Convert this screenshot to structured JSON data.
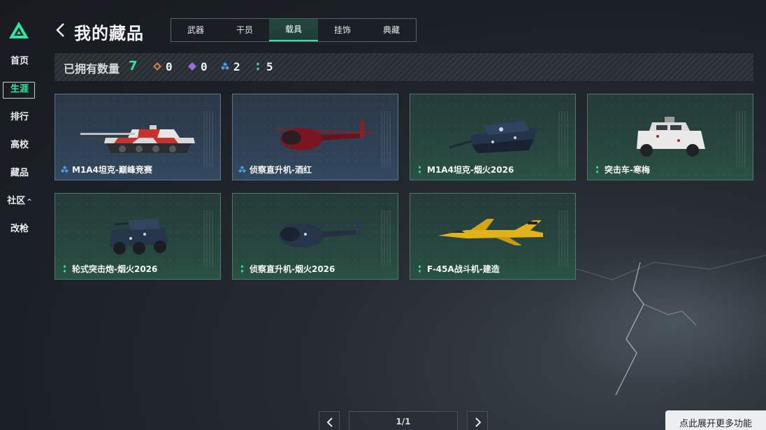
{
  "sidebar": {
    "items": [
      {
        "label": "首页"
      },
      {
        "label": "生涯"
      },
      {
        "label": "排行"
      },
      {
        "label": "高校"
      },
      {
        "label": "藏品"
      },
      {
        "label": "社区"
      },
      {
        "label": "改枪"
      }
    ],
    "active_index": 1
  },
  "header": {
    "title": "我的藏品",
    "tabs": [
      {
        "label": "武器"
      },
      {
        "label": "干员"
      },
      {
        "label": "载具"
      },
      {
        "label": "挂饰"
      },
      {
        "label": "典藏"
      }
    ],
    "active_tab": "载具"
  },
  "owned": {
    "label": "已拥有数量",
    "total": "7",
    "rarities": [
      {
        "icon": "orange-diamond-icon",
        "color": "#d9784a",
        "count": "0"
      },
      {
        "icon": "purple-diamond-icon",
        "color": "#9b6bdc",
        "count": "0"
      },
      {
        "icon": "blue-diamond-icon",
        "color": "#4c9ce0",
        "count": "2"
      },
      {
        "icon": "green-diamond-icon",
        "color": "#2ee6a0",
        "count": "5"
      }
    ]
  },
  "items": [
    {
      "name": "M1A4坦克-巅峰竞赛",
      "rarity": "blue",
      "icon": "blue-diamond-icon",
      "image": "red-white-tank"
    },
    {
      "name": "侦察直升机-酒红",
      "rarity": "blue",
      "icon": "blue-diamond-icon",
      "image": "wine-red-helicopter"
    },
    {
      "name": "M1A4坦克-烟火2026",
      "rarity": "green",
      "icon": "green-diamond-icon",
      "image": "navy-fireworks-tank"
    },
    {
      "name": "突击车-寒梅",
      "rarity": "green",
      "icon": "green-diamond-icon",
      "image": "white-plum-assault-vehicle"
    },
    {
      "name": "轮式突击炮-烟火2026",
      "rarity": "green",
      "icon": "green-diamond-icon",
      "image": "fireworks-wheeled-assault-gun"
    },
    {
      "name": "侦察直升机-烟火2026",
      "rarity": "green",
      "icon": "green-diamond-icon",
      "image": "fireworks-helicopter"
    },
    {
      "name": "F-45A战斗机-建造",
      "rarity": "green",
      "icon": "green-diamond-icon",
      "image": "yellow-fighter-jet"
    }
  ],
  "pagination": {
    "indicator": "1/1"
  },
  "expand_button": {
    "label": "点此展开更多功能"
  },
  "colors": {
    "accent": "#2ee6a0",
    "blue_rarity": "#4c9ce0"
  }
}
